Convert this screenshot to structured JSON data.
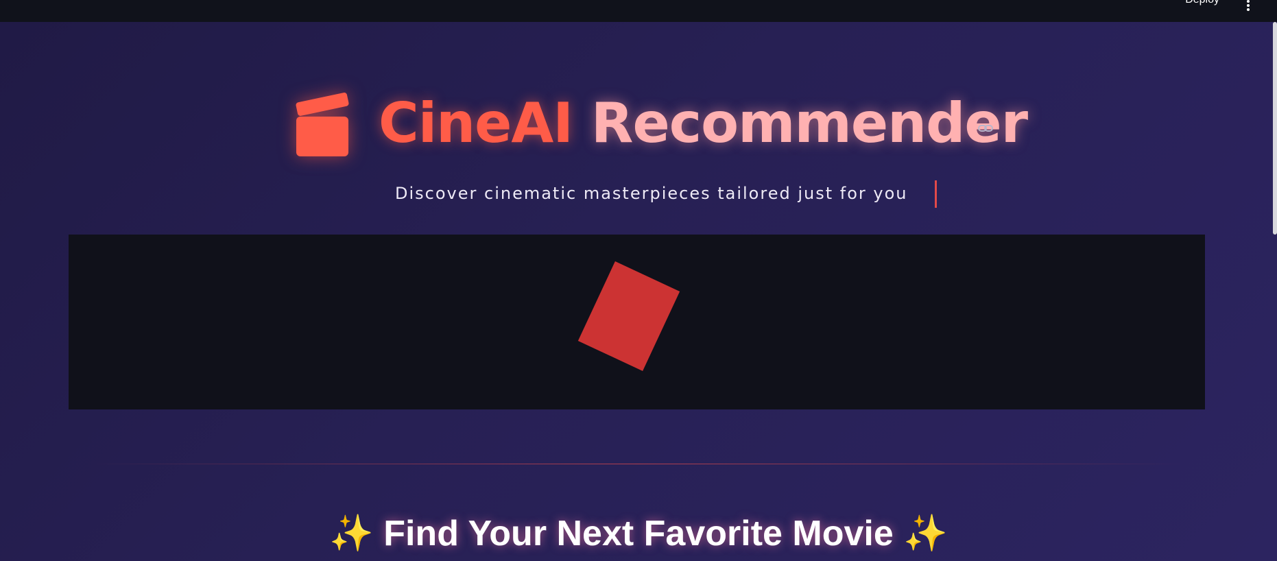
{
  "topbar": {
    "deploy_label": "Deploy",
    "menu_icon": "vertical-ellipsis-icon"
  },
  "hero": {
    "icon": "clapperboard-icon",
    "title_brand": "CineAI",
    "title_rest": "Recommender",
    "link_icon": "link-icon",
    "subtitle": "Discover cinematic masterpieces tailored just for you"
  },
  "section": {
    "sparkle_left": "✨",
    "heading": "Find Your Next Favorite Movie",
    "sparkle_right": "✨"
  },
  "colors": {
    "background": "#272054",
    "topbar": "#10121b",
    "brand": "#ff5c48",
    "title_rest": "#ffb1b1",
    "accent": "#e24a4a",
    "panel": "#10111a",
    "card": "#cc3333"
  }
}
